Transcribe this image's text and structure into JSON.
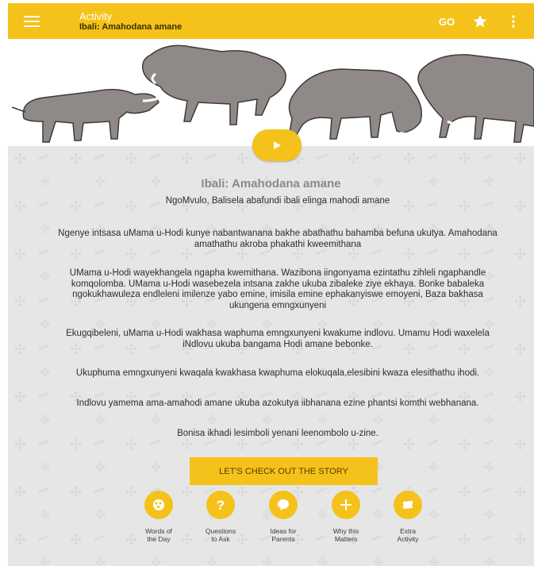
{
  "appbar": {
    "title": "Activity",
    "subtitle": "Ibali: Amahodana amane",
    "bg_color": "#f5c21b",
    "actions": [
      {
        "icon": "go-icon",
        "label": "GO"
      },
      {
        "icon": "star-icon"
      },
      {
        "icon": "more-vert-icon"
      }
    ]
  },
  "hero": {
    "image": "warthogs-illustration",
    "play_icon": "play-icon"
  },
  "story": {
    "title": "Ibali: Amahodana amane",
    "intro": "NgoMvulo, Balisela abafundi ibali elinga mahodi amane",
    "paragraphs": [
      "Ngenye intsasa uMama u-Hodi kunye nabantwanana bakhe abathathu bahamba befuna ukutya. Amahodana amathathu akroba phakathi kweemithana",
      "UMama u-Hodi wayekhangela ngapha kwemithana. Wazibona iingonyama ezintathu zihleli ngaphandle komqolomba. UMama u-Hodi wasebezela intsana zakhe ukuba zibaleke ziye ekhaya. Bonke babaleka ngokukhawuleza endleleni imilenze yabo emine, imisila emine ephakanyiswe emoyeni, Baza bakhasa ukungena emngxunyeni",
      "Ekugqibeleni, uMama u-Hodi wakhasa waphuma emngxunyeni kwakume indlovu. Umamu Hodi waxelela iNdlovu ukuba bangama Hodi amane bebonke.",
      "Ukuphuma emngxunyeni kwaqala kwakhasa kwaphuma elokuqala,elesibini kwaza elesithathu ihodi.",
      "Indlovu yamema ama-amahodi amane ukuba azokutya iibhanana ezine phantsi komthi webhanana.",
      "Bonisa ikhadi lesimboli yenani leenombolo u-zine."
    ]
  },
  "cta": {
    "label": "LET'S CHECK OUT THE STORY"
  },
  "bottom_icons": [
    {
      "icon": "words-icon",
      "label_lines": [
        "Words of",
        "the Day"
      ]
    },
    {
      "icon": "question-icon",
      "label_lines": [
        "Questions",
        "to Ask"
      ]
    },
    {
      "icon": "chat-icon",
      "label_lines": [
        "Ideas for",
        "Parents"
      ]
    },
    {
      "icon": "plus-icon",
      "label_lines": [
        "Why this",
        "Matters"
      ]
    },
    {
      "icon": "ticket-icon",
      "label_lines": [
        "Extra",
        "Activity"
      ]
    }
  ],
  "colors": {
    "accent": "#f5c21b",
    "content_bg": "#e6e6e6",
    "title_gray": "#8a8a8a"
  }
}
